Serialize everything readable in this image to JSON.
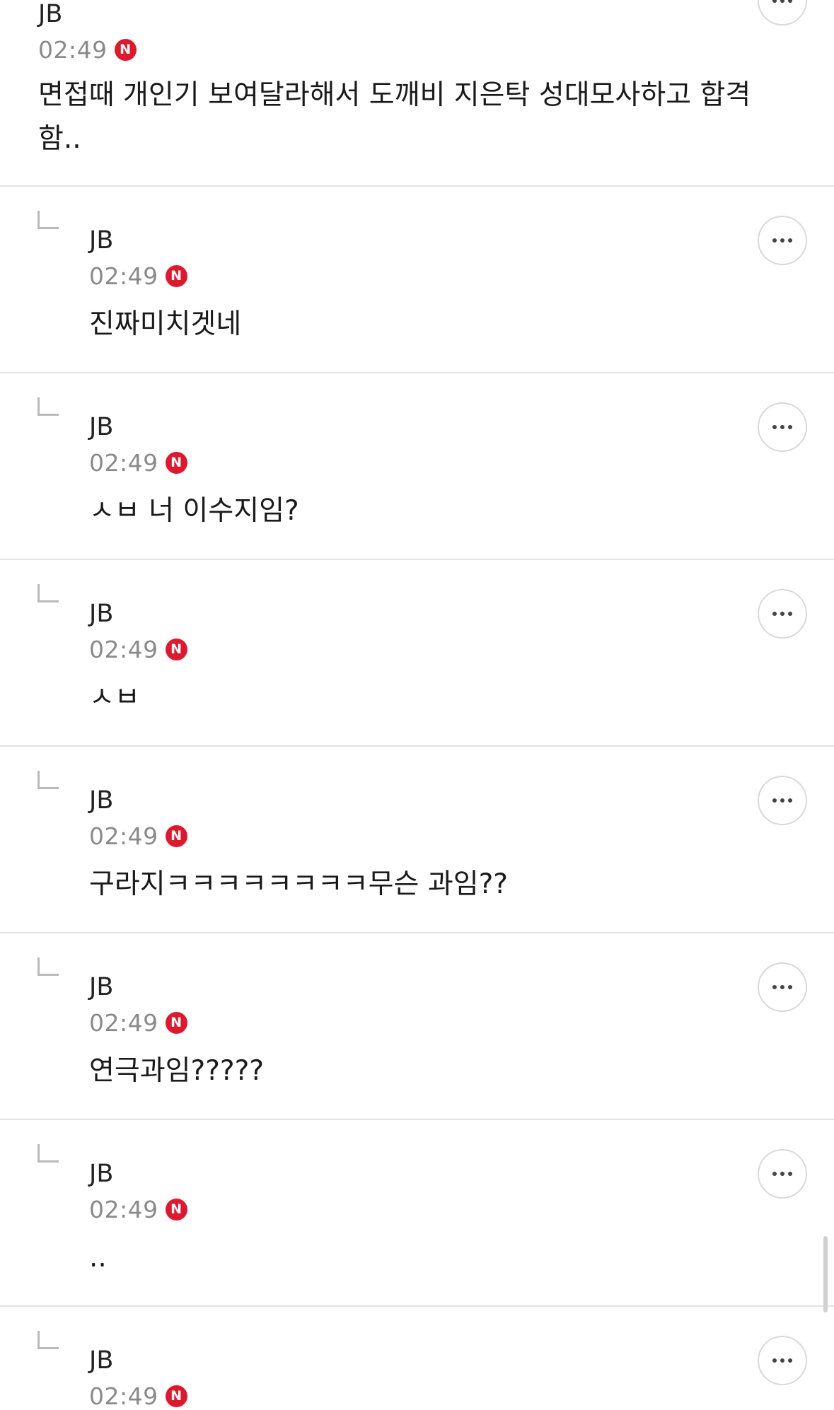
{
  "badge": {
    "label": "N",
    "color": "#e0182d"
  },
  "icons": {
    "more": "more-horizontal-icon",
    "reply": "reply-arrow-icon"
  },
  "comments": [
    {
      "author": "JB",
      "time": "02:49",
      "text": "면접때 개인기 보여달라해서 도깨비 지은탁 성대모사하고 합격\n함..",
      "is_reply": false
    },
    {
      "author": "JB",
      "time": "02:49",
      "text": "진짜미치겟네",
      "is_reply": true
    },
    {
      "author": "JB",
      "time": "02:49",
      "text": "ㅅㅂ 너 이수지임?",
      "is_reply": true
    },
    {
      "author": "JB",
      "time": "02:49",
      "text": "ㅅㅂ",
      "is_reply": true
    },
    {
      "author": "JB",
      "time": "02:49",
      "text": "구라지ㅋㅋㅋㅋㅋㅋㅋㅋ무슨 과임??",
      "is_reply": true
    },
    {
      "author": "JB",
      "time": "02:49",
      "text": "연극과임?????",
      "is_reply": true
    },
    {
      "author": "JB",
      "time": "02:49",
      "text": "..",
      "is_reply": true
    },
    {
      "author": "JB",
      "time": "02:49",
      "text": "",
      "is_reply": true
    }
  ]
}
